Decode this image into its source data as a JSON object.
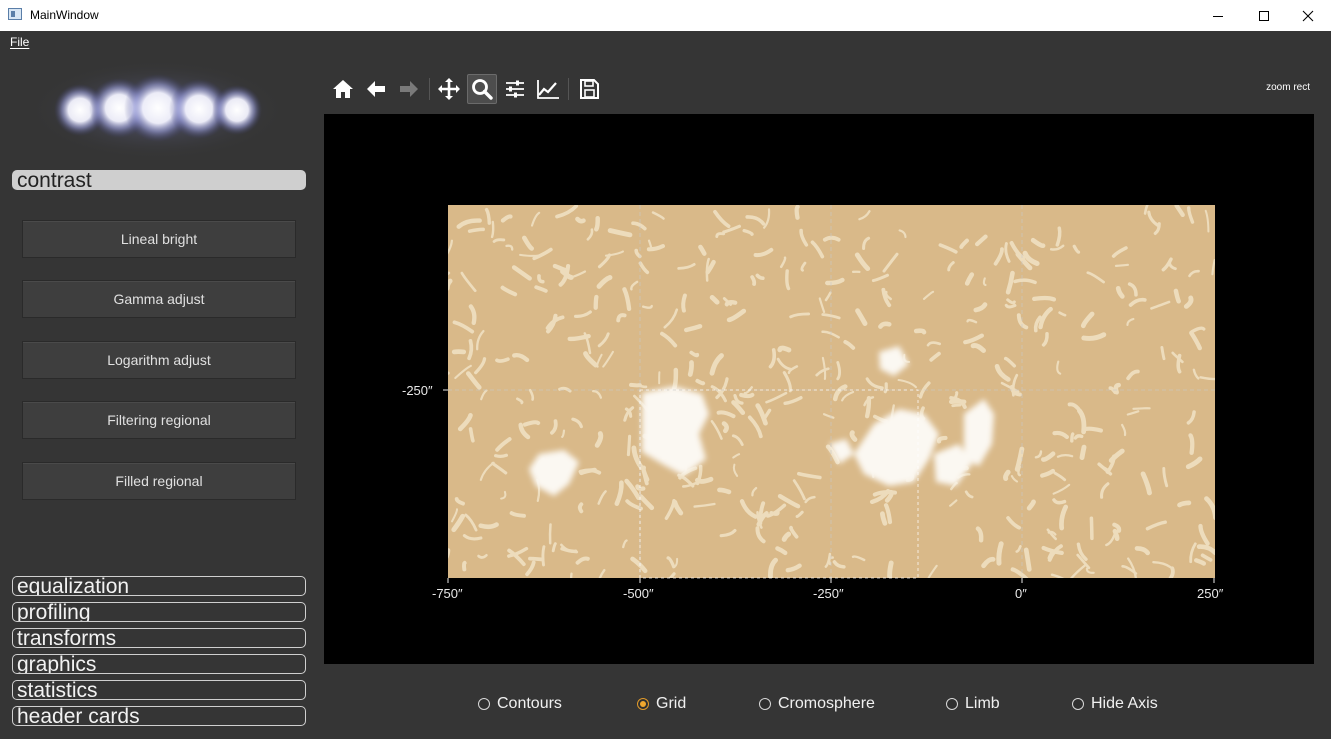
{
  "window": {
    "title": "MainWindow"
  },
  "menu": {
    "file": "File"
  },
  "sidebar": {
    "active_section": "contrast",
    "buttons": [
      "Lineal bright",
      "Gamma adjust",
      "Logarithm adjust",
      "Filtering regional",
      "Filled regional"
    ],
    "sections": [
      "equalization",
      "profiling",
      "transforms",
      "graphics",
      "statistics",
      "header cards"
    ]
  },
  "toolbar": {
    "icons": [
      "home-icon",
      "back-arrow-icon",
      "forward-arrow-icon",
      "pan-icon",
      "zoom-icon",
      "subplots-icon",
      "axes-edit-icon",
      "save-icon"
    ],
    "active_tool": "zoom-icon",
    "status": "zoom rect"
  },
  "plot": {
    "x_ticks": [
      "-750″",
      "-500″",
      "-250″",
      "0″",
      "250″"
    ],
    "y_ticks": [
      "-250″"
    ],
    "grid": true,
    "image_color": "#d9b989"
  },
  "options": [
    {
      "label": "Contours",
      "checked": false
    },
    {
      "label": "Grid",
      "checked": true
    },
    {
      "label": "Cromosphere",
      "checked": false
    },
    {
      "label": "Limb",
      "checked": false
    },
    {
      "label": "Hide Axis",
      "checked": false
    }
  ]
}
